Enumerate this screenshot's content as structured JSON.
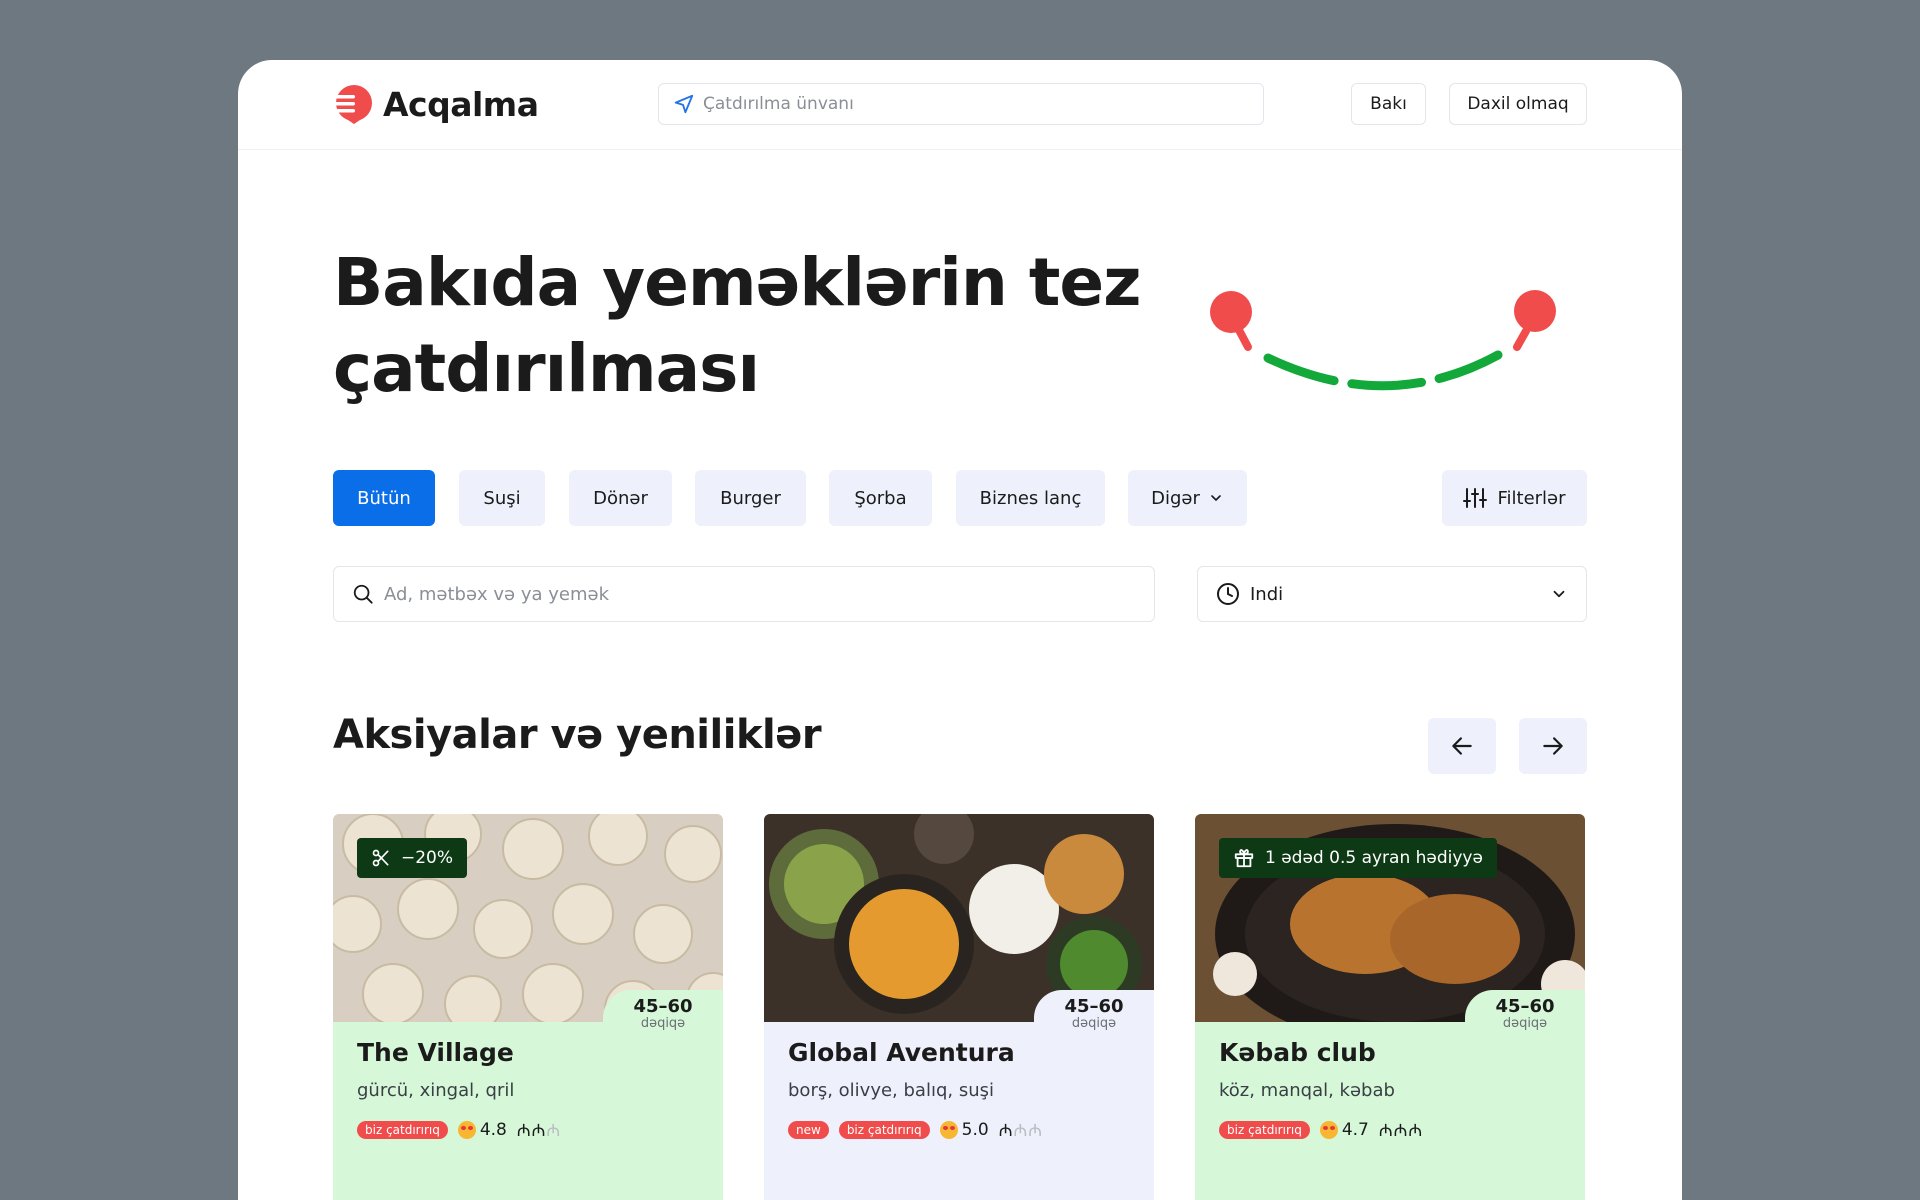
{
  "header": {
    "brand": "Acqalma",
    "address_placeholder": "Çatdırılma ünvanı",
    "city_label": "Bakı",
    "login_label": "Daxil olmaq"
  },
  "hero": {
    "title": "Bakıda yeməklərin tez çatdırılması"
  },
  "categories": {
    "items": [
      "Bütün",
      "Suşi",
      "Dönər",
      "Burger",
      "Şorba",
      "Biznes lanç",
      "Digər"
    ],
    "active": "Bütün",
    "filters_label": "Filterlər"
  },
  "search": {
    "placeholder": "Ad, mətbəx və ya yemək",
    "time_value": "Indi"
  },
  "promos": {
    "title": "Aksiyalar və yeniliklər",
    "cards": [
      {
        "name": "The Village",
        "cuisine": "gürcü, xingal, qril",
        "eta": "45–60",
        "eta_unit": "dəqiqə",
        "badges": [
          "biz çatdırırıq"
        ],
        "rating": "4.8",
        "price_level": 2,
        "price_max": 3,
        "promo": "−20%",
        "promo_icon": "scissors-icon",
        "theme": "green"
      },
      {
        "name": "Global Aventura",
        "cuisine": "borş, olivye, balıq, suşi",
        "eta": "45–60",
        "eta_unit": "dəqiqə",
        "badges": [
          "new",
          "biz çatdırırıq"
        ],
        "rating": "5.0",
        "price_level": 1,
        "price_max": 3,
        "promo": "",
        "theme": "blue"
      },
      {
        "name": "Kəbab club",
        "cuisine": "köz, manqal, kəbab",
        "eta": "45–60",
        "eta_unit": "dəqiqə",
        "badges": [
          "biz çatdırırıq"
        ],
        "rating": "4.7",
        "price_level": 3,
        "price_max": 3,
        "promo": "1 ədəd 0.5 ayran hədiyyə",
        "promo_icon": "gift-icon",
        "theme": "green"
      }
    ]
  },
  "colors": {
    "accent": "#0a6ee8",
    "brand_red": "#f04c4c",
    "route_green": "#12a83a",
    "card_green": "#d6f8d9",
    "card_blue": "#eef1fb"
  }
}
